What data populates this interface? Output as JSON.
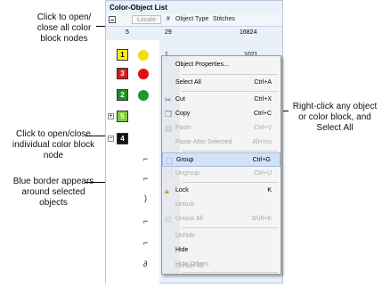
{
  "panel": {
    "title": "Color-Object List",
    "locate_label": "Locate",
    "col_hash": "#",
    "col_object_type": "Object Type",
    "col_stitches": "Stitches",
    "summary_row": {
      "count": "5",
      "objects": "29",
      "stitches": "16824"
    },
    "first_row": {
      "num": "1",
      "stitches": "1021"
    },
    "blocks": [
      {
        "label": "1",
        "color": "#f7ef1a",
        "blob": "#f0e000"
      },
      {
        "label": "3",
        "color": "#d11f1f",
        "blob": "#e01010"
      },
      {
        "label": "2",
        "color": "#1e8f2a",
        "blob": "#1c9a2a"
      },
      {
        "label": "5",
        "color": "#7ecb3a",
        "blob": ""
      },
      {
        "label": "4",
        "color": "#111111",
        "blob": ""
      }
    ]
  },
  "context_menu": {
    "items": [
      {
        "label": "Object Properties...",
        "shortcut": "",
        "disabled": false
      },
      {
        "label": "Select All",
        "shortcut": "Ctrl+A",
        "disabled": false
      },
      {
        "label": "Cut",
        "shortcut": "Ctrl+X",
        "disabled": false
      },
      {
        "label": "Copy",
        "shortcut": "Ctrl+C",
        "disabled": false
      },
      {
        "label": "Paste",
        "shortcut": "Ctrl+V",
        "disabled": true
      },
      {
        "label": "Paste After Selected",
        "shortcut": "Alt+Ins",
        "disabled": true
      },
      {
        "label": "Group",
        "shortcut": "Ctrl+G",
        "disabled": false
      },
      {
        "label": "Ungroup",
        "shortcut": "Ctrl+U",
        "disabled": true
      },
      {
        "label": "Lock",
        "shortcut": "K",
        "disabled": false
      },
      {
        "label": "Unlock",
        "shortcut": "",
        "disabled": true
      },
      {
        "label": "Unlock All",
        "shortcut": "Shift+K",
        "disabled": true
      },
      {
        "label": "Unhide",
        "shortcut": "",
        "disabled": true
      },
      {
        "label": "Hide",
        "shortcut": "",
        "disabled": false
      },
      {
        "label": "Hide Others",
        "shortcut": "",
        "disabled": true
      },
      {
        "label": "Unhide All",
        "shortcut": "",
        "disabled": true
      }
    ]
  },
  "callouts": {
    "collapse_all": "Click to open/ close all color block nodes",
    "open_close_individual": "Click to open/close individual color block node",
    "blue_border": "Blue border appears around selected objects",
    "right_click": "Right-click any object or color block, and Select All"
  }
}
